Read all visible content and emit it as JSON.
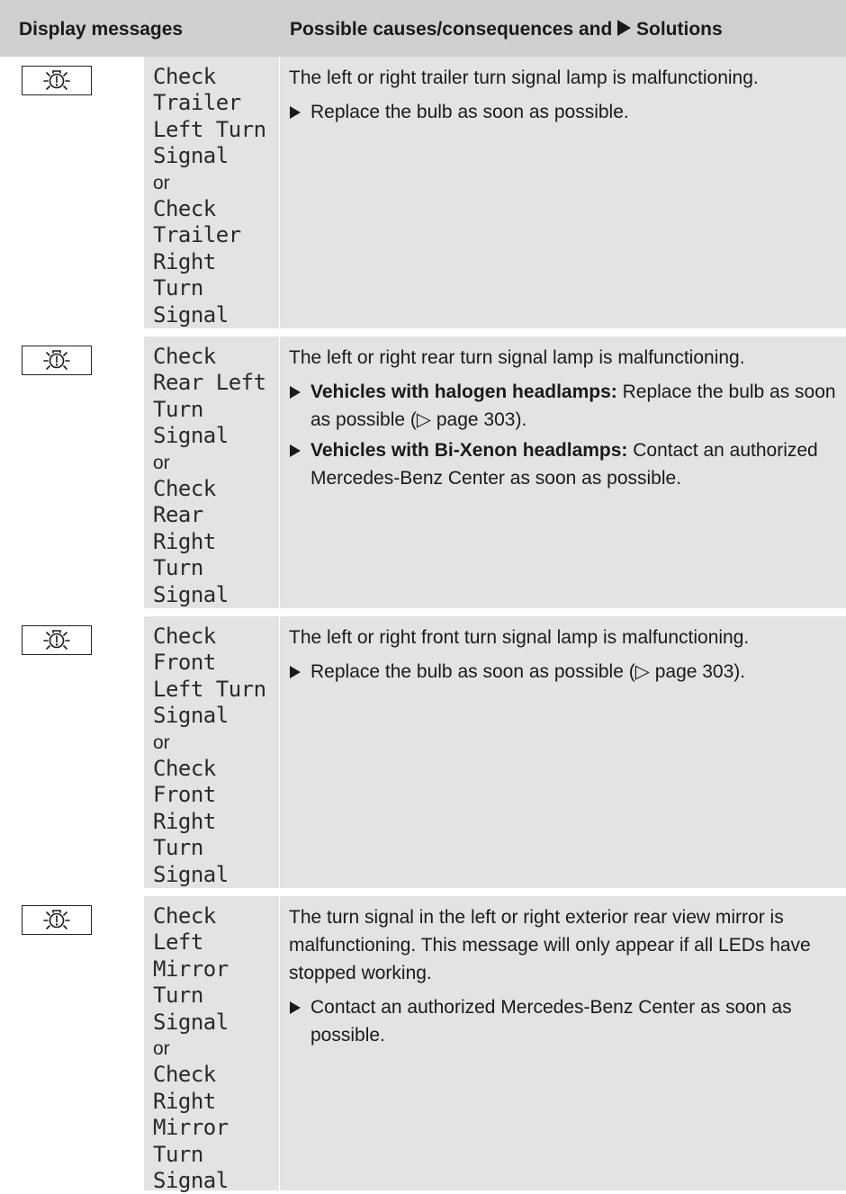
{
  "header": {
    "col1": "Display messages",
    "col2_before": "Possible causes/consequences and",
    "col2_after": "Solutions",
    "col2_icon": "action-triangle-icon"
  },
  "colors": {
    "header_bg": "#cfcfcf",
    "cell_bg": "#e3e3e3"
  },
  "rows": [
    {
      "icon": "bulb-warning-icon",
      "msg1": [
        "Check",
        "Trailer",
        "Left Turn",
        "Signal"
      ],
      "or": "or",
      "msg2": [
        "Check",
        "Trailer",
        "Right",
        "Turn",
        "Signal"
      ],
      "cause": "The left or right trailer turn signal lamp is malfunctioning.",
      "steps": [
        {
          "bold": "",
          "text": "Replace the bulb as soon as possible."
        }
      ]
    },
    {
      "icon": "bulb-warning-icon",
      "msg1": [
        "Check",
        "Rear Left",
        "Turn",
        "Signal"
      ],
      "or": "or",
      "msg2": [
        "Check",
        "Rear",
        "Right",
        "Turn",
        "Signal"
      ],
      "cause": "The left or right rear turn signal lamp is malfunctioning.",
      "steps": [
        {
          "bold": "Vehicles with halogen headlamps:",
          "text": " Replace the bulb as soon as possible (▷ page 303)."
        },
        {
          "bold": "Vehicles with Bi-Xenon headlamps:",
          "text": " Contact an authorized Mercedes-Benz Center as soon as possible."
        }
      ]
    },
    {
      "icon": "bulb-warning-icon",
      "msg1": [
        "Check",
        "Front",
        "Left Turn",
        "Signal"
      ],
      "or": "or",
      "msg2": [
        "Check",
        "Front",
        "Right",
        "Turn",
        "Signal"
      ],
      "cause": "The left or right front turn signal lamp is malfunctioning.",
      "steps": [
        {
          "bold": "",
          "text": "Replace the bulb as soon as possible (▷ page 303)."
        }
      ]
    },
    {
      "icon": "bulb-warning-icon",
      "msg1": [
        "Check",
        "Left",
        "Mirror",
        "Turn",
        "Signal"
      ],
      "or": "or",
      "msg2": [
        "Check",
        "Right",
        "Mirror",
        "Turn",
        "Signal"
      ],
      "cause": "The turn signal in the left or right exterior rear view mirror is malfunctioning. This message will only appear if all LEDs have stopped working.",
      "steps": [
        {
          "bold": "",
          "text": "Contact an authorized Mercedes-Benz Center as soon as possible."
        }
      ]
    }
  ]
}
